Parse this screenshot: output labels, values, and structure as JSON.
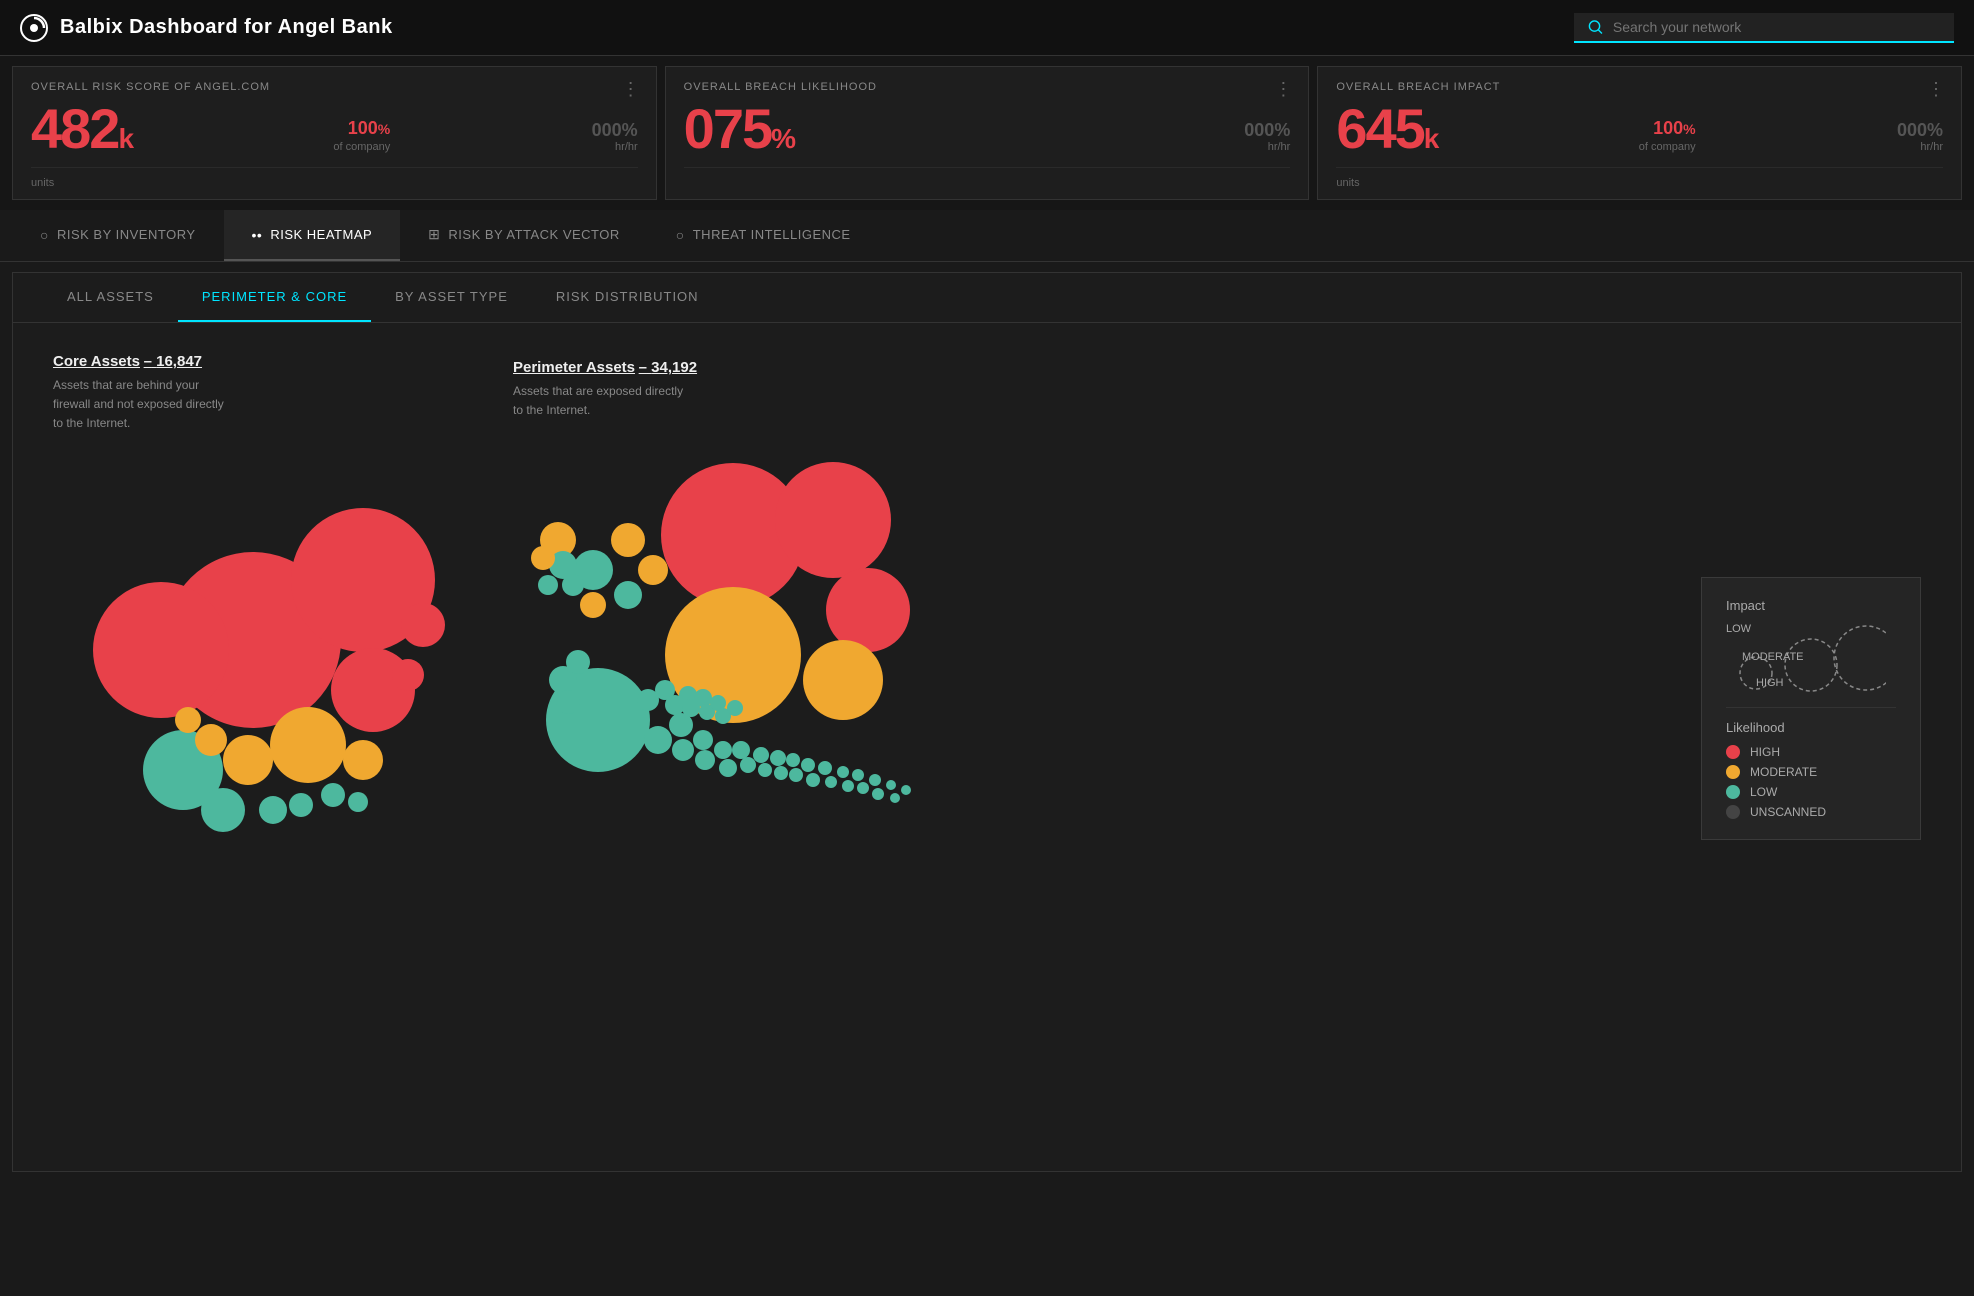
{
  "header": {
    "title": "Balbix Dashboard for Angel Bank",
    "search_placeholder": "Search your network"
  },
  "metrics": [
    {
      "id": "risk-score",
      "label": "OVERALL RISK SCORE OF ANGEL.COM",
      "main_value": "482",
      "main_suffix": "k",
      "sub_value": "100",
      "sub_suffix": "%",
      "sub_label": "of company",
      "side_value": "000",
      "side_suffix": "%",
      "side_label": "hr/hr",
      "bottom_label": "units"
    },
    {
      "id": "breach-likelihood",
      "label": "OVERALL BREACH LIKELIHOOD",
      "main_value": "075",
      "main_suffix": "%",
      "sub_value": "",
      "sub_suffix": "",
      "sub_label": "",
      "side_value": "000",
      "side_suffix": "%",
      "side_label": "hr/hr",
      "bottom_label": ""
    },
    {
      "id": "breach-impact",
      "label": "OVERALL BREACH IMPACT",
      "main_value": "645",
      "main_suffix": "k",
      "sub_value": "100",
      "sub_suffix": "%",
      "sub_label": "of company",
      "side_value": "000",
      "side_suffix": "%",
      "side_label": "hr/hr",
      "bottom_label": "units"
    }
  ],
  "main_tabs": [
    {
      "id": "risk-by-inventory",
      "label": "RISK BY INVENTORY",
      "icon": "○",
      "active": false
    },
    {
      "id": "risk-heatmap",
      "label": "RISK HEATMAP",
      "icon": "••",
      "active": true
    },
    {
      "id": "risk-by-attack-vector",
      "label": "RISK BY ATTACK VECTOR",
      "icon": "⊞",
      "active": false
    },
    {
      "id": "threat-intelligence",
      "label": "THREAT INTELLIGENCE",
      "icon": "○",
      "active": false
    }
  ],
  "sub_tabs": [
    {
      "id": "all-assets",
      "label": "ALL ASSETS",
      "active": false
    },
    {
      "id": "perimeter-core",
      "label": "PERIMETER & CORE",
      "active": true
    },
    {
      "id": "by-asset-type",
      "label": "BY ASSET TYPE",
      "active": false
    },
    {
      "id": "risk-distribution",
      "label": "RISK DISTRIBUTION",
      "active": false
    }
  ],
  "core_assets": {
    "title": "Core Assets",
    "separator": "–",
    "count": "16,847",
    "description": "Assets that are behind your firewall and not exposed directly to the Internet."
  },
  "perimeter_assets": {
    "title": "Perimeter Assets",
    "separator": "–",
    "count": "34,192",
    "description": "Assets that are exposed directly to the Internet."
  },
  "legend": {
    "impact_title": "Impact",
    "impact_levels": [
      {
        "id": "low",
        "label": "LOW"
      },
      {
        "id": "moderate",
        "label": "MODERATE"
      },
      {
        "id": "high",
        "label": "HIGH"
      }
    ],
    "likelihood_title": "Likelihood",
    "likelihood_items": [
      {
        "id": "high",
        "label": "HIGH",
        "color": "red"
      },
      {
        "id": "moderate",
        "label": "MODERATE",
        "color": "orange"
      },
      {
        "id": "low",
        "label": "LOW",
        "color": "teal"
      },
      {
        "id": "unscanned",
        "label": "UNSCANNED",
        "color": "dark"
      }
    ]
  }
}
